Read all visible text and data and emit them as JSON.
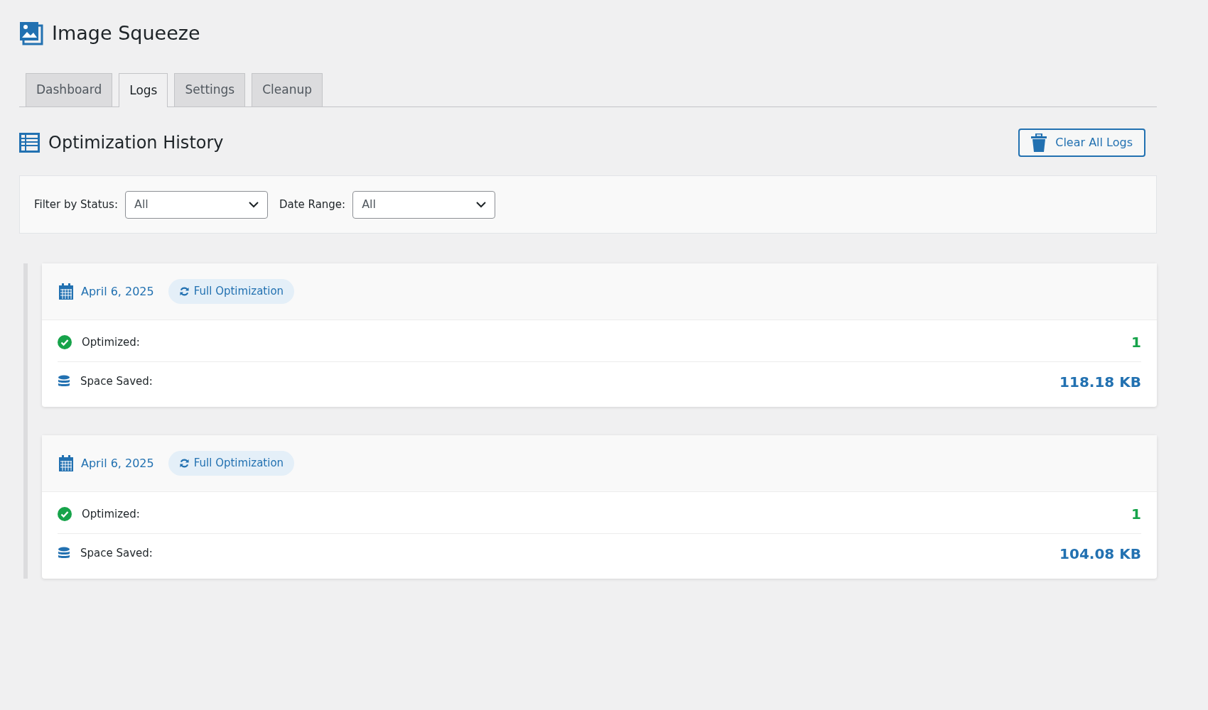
{
  "app": {
    "title": "Image Squeeze"
  },
  "tabs": [
    {
      "label": "Dashboard",
      "selected": false
    },
    {
      "label": "Logs",
      "selected": true
    },
    {
      "label": "Settings",
      "selected": false
    },
    {
      "label": "Cleanup",
      "selected": false
    }
  ],
  "section": {
    "title": "Optimization History",
    "clear_button": "Clear All Logs"
  },
  "filters": [
    {
      "label": "Filter by Status:",
      "value": "All"
    },
    {
      "label": "Date Range:",
      "value": "All"
    }
  ],
  "logs": [
    {
      "date": "April 6, 2025",
      "type": "Full Optimization",
      "stats": [
        {
          "kind": "optimized",
          "label": "Optimized:",
          "value": "1"
        },
        {
          "kind": "space",
          "label": "Space Saved:",
          "value": "118.18 KB"
        }
      ]
    },
    {
      "date": "April 6, 2025",
      "type": "Full Optimization",
      "stats": [
        {
          "kind": "optimized",
          "label": "Optimized:",
          "value": "1"
        },
        {
          "kind": "space",
          "label": "Space Saved:",
          "value": "104.08 KB"
        }
      ]
    }
  ]
}
